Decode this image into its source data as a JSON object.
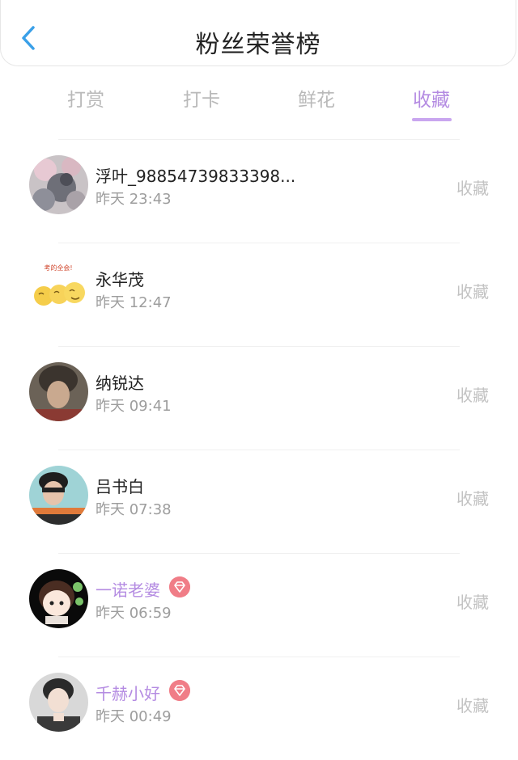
{
  "header": {
    "title": "粉丝荣誉榜",
    "back_icon": "back-arrow-icon"
  },
  "tabs": [
    {
      "label": "打赏",
      "active": false
    },
    {
      "label": "打卡",
      "active": false
    },
    {
      "label": "鲜花",
      "active": false
    },
    {
      "label": "收藏",
      "active": true
    }
  ],
  "colors": {
    "accent": "#b48be2",
    "badge": "#f07d87",
    "back": "#3aa0e8"
  },
  "rows": [
    {
      "name": "浮叶_98854739833398...",
      "time": "昨天 23:43",
      "action": "收藏",
      "vip": false
    },
    {
      "name": "永华茂",
      "time": "昨天 12:47",
      "action": "收藏",
      "vip": false
    },
    {
      "name": "纳锐达",
      "time": "昨天 09:41",
      "action": "收藏",
      "vip": false
    },
    {
      "name": "吕书白",
      "time": "昨天 07:38",
      "action": "收藏",
      "vip": false
    },
    {
      "name": "一诺老婆",
      "time": "昨天 06:59",
      "action": "收藏",
      "vip": true
    },
    {
      "name": "千赫小好",
      "time": "昨天 00:49",
      "action": "收藏",
      "vip": true
    }
  ],
  "avatar_images": {
    "row0_text": "",
    "row1_text": "考的全会!"
  }
}
